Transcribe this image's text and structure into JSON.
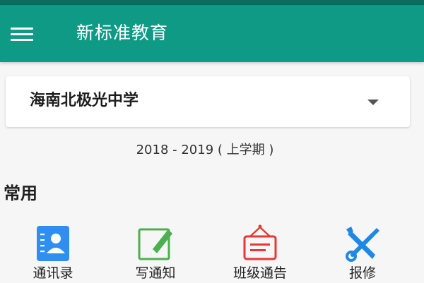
{
  "app_bar": {
    "title": "新标准教育",
    "menu_icon": "hamburger-menu-icon"
  },
  "school_selector": {
    "selected": "海南北极光中学",
    "dropdown_icon": "caret-down-icon"
  },
  "term": "2018 - 2019 ( 上学期 )",
  "section": {
    "title": "常用"
  },
  "shortcuts": [
    {
      "label": "通讯录",
      "icon": "contacts-icon",
      "color": "#2f8ef0"
    },
    {
      "label": "写通知",
      "icon": "edit-notice-icon",
      "color": "#4caf50"
    },
    {
      "label": "班级通告",
      "icon": "bulletin-board-icon",
      "color": "#e53935"
    },
    {
      "label": "报修",
      "icon": "repair-tools-icon",
      "color": "#1e88e5"
    }
  ],
  "colors": {
    "primary": "#0f9a86",
    "primary_dark": "#0b6b5d",
    "background": "#f6f6f6"
  }
}
